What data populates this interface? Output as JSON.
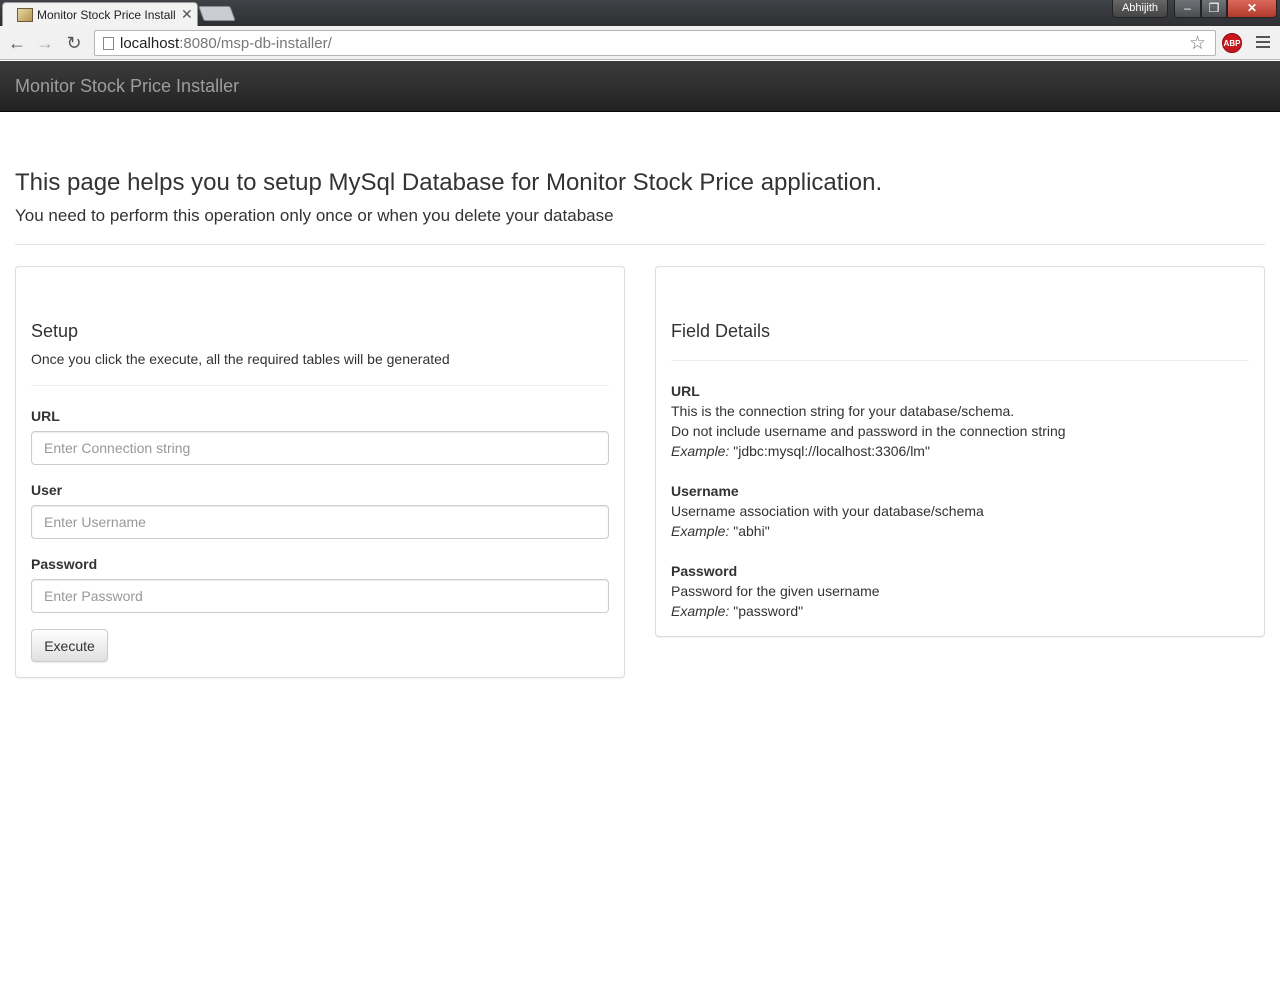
{
  "browser": {
    "tab_title": "Monitor Stock Price Install",
    "tab_close": "✕",
    "profile_name": "Abhijith",
    "win_min": "‒",
    "win_max": "❐",
    "win_close": "✕",
    "url_host": "localhost",
    "url_rest": ":8080/msp-db-installer/",
    "abp_label": "ABP",
    "back_glyph": "←",
    "fwd_glyph": "→",
    "reload_glyph": "↻",
    "star_glyph": "☆"
  },
  "navbar": {
    "brand": "Monitor Stock Price Installer"
  },
  "header": {
    "title": "This page helps you to setup MySql Database for Monitor Stock Price application.",
    "subtitle": "You need to perform this operation only once or when you delete your database"
  },
  "setup": {
    "title": "Setup",
    "description": "Once you click the execute, all the required tables will be generated",
    "fields": [
      {
        "label": "URL",
        "placeholder": "Enter Connection string",
        "value": ""
      },
      {
        "label": "User",
        "placeholder": "Enter Username",
        "value": ""
      },
      {
        "label": "Password",
        "placeholder": "Enter Password",
        "value": ""
      }
    ],
    "execute_label": "Execute"
  },
  "details": {
    "title": "Field Details",
    "example_label": "Example:",
    "items": [
      {
        "name": "URL",
        "lines": [
          "This is the connection string for your database/schema.",
          "Do not include username and password in the connection string"
        ],
        "example": "\"jdbc:mysql://localhost:3306/lm\""
      },
      {
        "name": "Username",
        "lines": [
          "Username association with your database/schema"
        ],
        "example": "\"abhi\""
      },
      {
        "name": "Password",
        "lines": [
          "Password for the given username"
        ],
        "example": "\"password\""
      }
    ]
  },
  "colors": {
    "navbar_bg": "#222222",
    "brand_text": "#9d9d9d",
    "abp_red": "#c7161d"
  }
}
